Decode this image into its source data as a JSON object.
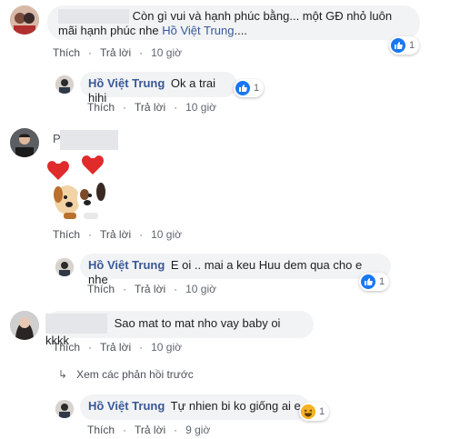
{
  "comments": [
    {
      "text": "Còn gì vui và hạnh phúc bằng... một GĐ nhỏ luôn mãi hạnh phúc nhe",
      "mention": "Hồ Việt Trung",
      "text_after": "....",
      "reaction_count": "1",
      "actions": {
        "like": "Thích",
        "reply": "Trả lời",
        "time": "10 giờ"
      },
      "reply": {
        "author": "Hồ Việt Trung",
        "text": "Ok a trai hihi",
        "reaction_count": "1",
        "actions": {
          "like": "Thích",
          "reply": "Trả lời",
          "time": "10 giờ"
        }
      }
    },
    {
      "author_initial": "P",
      "sticker": "puppy-hearts-sticker",
      "actions": {
        "like": "Thích",
        "reply": "Trả lời",
        "time": "10 giờ"
      },
      "reply": {
        "author": "Hồ Việt Trung",
        "text": "E oi .. mai a keu Huu dem qua cho e nhe",
        "reaction_count": "1",
        "actions": {
          "like": "Thích",
          "reply": "Trả lời",
          "time": "10 giờ"
        }
      }
    },
    {
      "text": "Sao mat to mat nho vay baby oi kkkk",
      "actions": {
        "like": "Thích",
        "reply": "Trả lời",
        "time": "10 giờ"
      },
      "view_previous": "Xem các phản hồi trước",
      "reply": {
        "author": "Hồ Việt Trung",
        "text": "Tự nhien bi ko giống ai e",
        "reaction_count": "1",
        "actions": {
          "like": "Thích",
          "reply": "Trả lời",
          "time": "9 giờ"
        }
      }
    }
  ],
  "colors": {
    "link": "#385898",
    "bubble": "#f2f3f5",
    "meta": "#606770",
    "like": "#1877f2",
    "haha": "#f7b125"
  },
  "icons": [
    "like-icon",
    "haha-icon",
    "reply-arrow-icon"
  ]
}
